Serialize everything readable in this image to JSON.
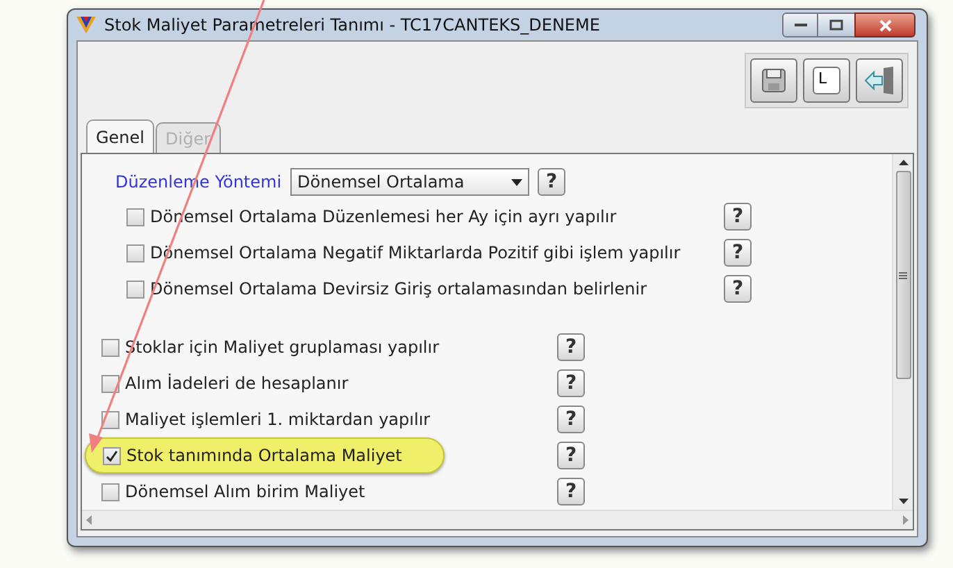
{
  "window": {
    "title": "Stok Maliyet Parametreleri Tanımı - TC17CANTEKS_DENEME"
  },
  "toolbar": {
    "buttons": [
      {
        "kind": "save"
      },
      {
        "kind": "text",
        "label": "L"
      },
      {
        "kind": "exit"
      }
    ]
  },
  "tabs": [
    {
      "label": "Genel",
      "selected": true,
      "disabled": false
    },
    {
      "label": "Diğer",
      "selected": false,
      "disabled": true
    }
  ],
  "method": {
    "label": "Düzenleme Yöntemi",
    "value": "Dönemsel Ortalama",
    "help": "?"
  },
  "sub_options": [
    {
      "label": "Dönemsel Ortalama Düzenlemesi her Ay için ayrı yapılır",
      "checked": false,
      "highlighted": false,
      "help": "?"
    },
    {
      "label": "Dönemsel Ortalama Negatif Miktarlarda Pozitif gibi işlem yapılır",
      "checked": false,
      "highlighted": false,
      "help": "?"
    },
    {
      "label": "Dönemsel Ortalama Devirsiz Giriş ortalamasından belirlenir",
      "checked": false,
      "highlighted": false,
      "help": "?"
    }
  ],
  "options": [
    {
      "label": "Stoklar için Maliyet gruplaması yapılır",
      "checked": false,
      "highlighted": false,
      "help": "?"
    },
    {
      "label": "Alım İadeleri de hesaplanır",
      "checked": false,
      "highlighted": false,
      "help": "?"
    },
    {
      "label": "Maliyet işlemleri 1. miktardan yapılır",
      "checked": false,
      "highlighted": false,
      "help": "?"
    },
    {
      "label": "Stok tanımında Ortalama Maliyet",
      "checked": true,
      "highlighted": true,
      "help": "?"
    },
    {
      "label": "Dönemsel Alım birim Maliyet",
      "checked": false,
      "highlighted": false,
      "help": "?"
    }
  ]
}
